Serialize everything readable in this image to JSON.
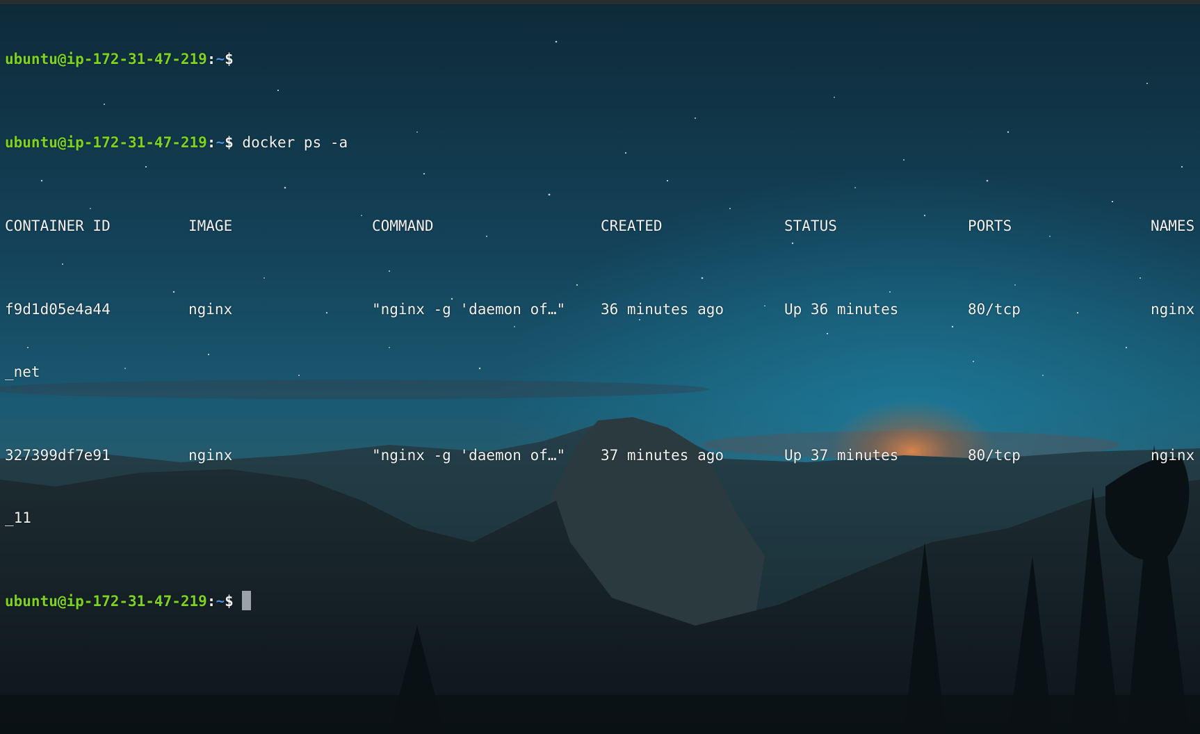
{
  "prompt": {
    "user_host": "ubuntu@ip-172-31-47-219",
    "separator": ":",
    "path": "~",
    "symbol": "$"
  },
  "command": "docker ps -a",
  "table": {
    "headers": [
      "CONTAINER ID",
      "IMAGE",
      "COMMAND",
      "CREATED",
      "STATUS",
      "PORTS",
      "NAMES"
    ],
    "rows": [
      {
        "cells": [
          "f9d1d05e4a44",
          "nginx",
          "\"nginx -g 'daemon of…\"",
          "36 minutes ago",
          "Up 36 minutes",
          "80/tcp",
          "nginx"
        ],
        "wrap": "_net"
      },
      {
        "cells": [
          "327399df7e91",
          "nginx",
          "\"nginx -g 'daemon of…\"",
          "37 minutes ago",
          "Up 37 minutes",
          "80/tcp",
          "nginx"
        ],
        "wrap": "_11"
      }
    ]
  },
  "colors": {
    "prompt_user": "#7ed321",
    "prompt_path": "#4a90e2",
    "text": "#f2f2f2",
    "cursor": "#9aa3a8"
  },
  "icons": {
    "cursor": "block-cursor-icon"
  }
}
